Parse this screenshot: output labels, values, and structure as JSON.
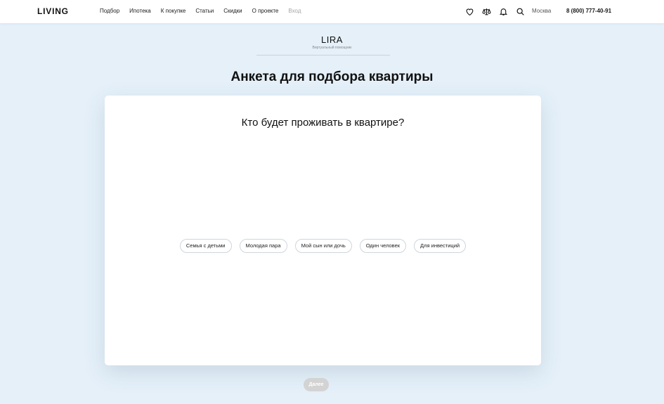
{
  "header": {
    "logo": "LIVING",
    "nav": [
      {
        "label": "Подбор"
      },
      {
        "label": "Ипотека"
      },
      {
        "label": "К покупке"
      },
      {
        "label": "Статьи"
      },
      {
        "label": "Скидки"
      },
      {
        "label": "О проекте"
      },
      {
        "label": "Вход"
      }
    ],
    "icons": [
      "heart-icon",
      "scales-icon",
      "bell-icon",
      "search-icon"
    ],
    "city": "Москва",
    "phone": "8 (800) 777-40-91"
  },
  "brand": {
    "name": "LIRA",
    "subtitle": "Виртуальный помощник"
  },
  "page": {
    "title": "Анкета для подбора квартиры"
  },
  "card": {
    "question": "Кто будет проживать в квартире?",
    "options": [
      {
        "label": "Семья с детьми"
      },
      {
        "label": "Молодая пара"
      },
      {
        "label": "Мой сын или дочь"
      },
      {
        "label": "Один человек"
      },
      {
        "label": "Для инвестиций"
      }
    ]
  },
  "next_button": {
    "label": "Далее",
    "enabled": false
  },
  "colors": {
    "background": "#e5f0f9",
    "button_disabled": "#d3d3d3",
    "muted_nav": "#a5a5a5"
  }
}
